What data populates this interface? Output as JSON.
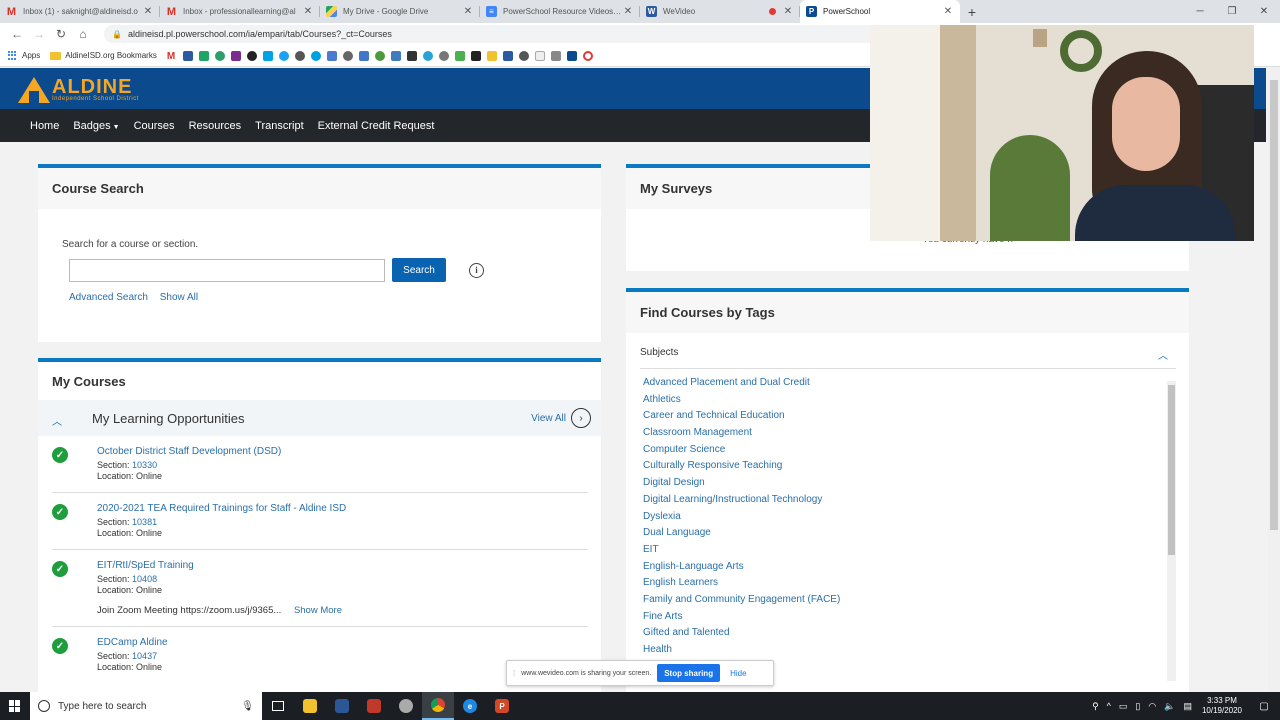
{
  "browser": {
    "tabs": [
      {
        "title": "Inbox (1) - saknight@aldineisd.o",
        "icon": "gmail-icon",
        "color": "#d93025"
      },
      {
        "title": "Inbox - professionallearning@al",
        "icon": "gmail-icon",
        "color": "#d93025"
      },
      {
        "title": "My Drive - Google Drive",
        "icon": "drive-icon",
        "color": "#1fa463"
      },
      {
        "title": "PowerSchool Resource Videos - G",
        "icon": "docs-icon",
        "color": "#4285f4"
      },
      {
        "title": "WeVideo",
        "icon": "wevideo-icon",
        "color": "#2c5aa0"
      },
      {
        "title": "PowerSchool",
        "icon": "powerschool-icon",
        "color": "#0b4a8c"
      }
    ],
    "url": "aldineisd.pl.powerschool.com/ia/empari/tab/Courses?_ct=Courses",
    "bookmarks": [
      {
        "label": "Apps"
      },
      {
        "label": "AldineISD.org Bookmarks"
      }
    ]
  },
  "logo": {
    "name": "ALDINE",
    "sub": "Independent School District"
  },
  "nav": {
    "home": "Home",
    "badges": "Badges",
    "courses": "Courses",
    "resources": "Resources",
    "transcript": "Transcript",
    "external": "External Credit Request"
  },
  "course_search": {
    "title": "Course Search",
    "prompt": "Search for a course or section.",
    "input_value": "",
    "search_button": "Search",
    "advanced": "Advanced Search",
    "show_all": "Show All"
  },
  "my_courses": {
    "title": "My Courses",
    "section_title": "My Learning Opportunities",
    "view_all": "View All",
    "items": [
      {
        "name": "October District Staff Development (DSD)",
        "section_label": "Section:",
        "section": "10330",
        "location": "Location: Online"
      },
      {
        "name": "2020-2021 TEA Required Trainings for Staff - Aldine ISD",
        "section_label": "Section:",
        "section": "10381",
        "location": "Location: Online"
      },
      {
        "name": "EIT/RtI/SpEd Training",
        "section_label": "Section:",
        "section": "10408",
        "location": "Location: Online",
        "extra": "Join Zoom Meeting https://zoom.us/j/9365...",
        "more": "Show More"
      },
      {
        "name": "EDCamp Aldine",
        "section_label": "Section:",
        "section": "10437",
        "location": "Location: Online"
      }
    ]
  },
  "surveys": {
    "title": "My Surveys",
    "text": "You currently have n"
  },
  "tags": {
    "title": "Find Courses by Tags",
    "subjects_label": "Subjects",
    "items": [
      "Advanced Placement and Dual Credit",
      "Athletics",
      "Career and Technical Education",
      "Classroom Management",
      "Computer Science",
      "Culturally Responsive Teaching",
      "Digital Design",
      "Digital Learning/Instructional Technology",
      "Dyslexia",
      "Dual Language",
      "EIT",
      "English-Language Arts",
      "English Learners",
      "Family and Community Engagement (FACE)",
      "Fine Arts",
      "Gifted and Talented",
      "Health"
    ]
  },
  "share": {
    "text": "www.wevideo.com is sharing your screen.",
    "stop": "Stop sharing",
    "hide": "Hide"
  },
  "taskbar": {
    "search_placeholder": "Type here to search",
    "time": "3:33 PM",
    "date": "10/19/2020"
  },
  "colors": {
    "accent": "#0a79c4",
    "header": "#0b4a8c",
    "nav": "#23262a",
    "link": "#2a6fa8",
    "check": "#1e9e3c"
  }
}
